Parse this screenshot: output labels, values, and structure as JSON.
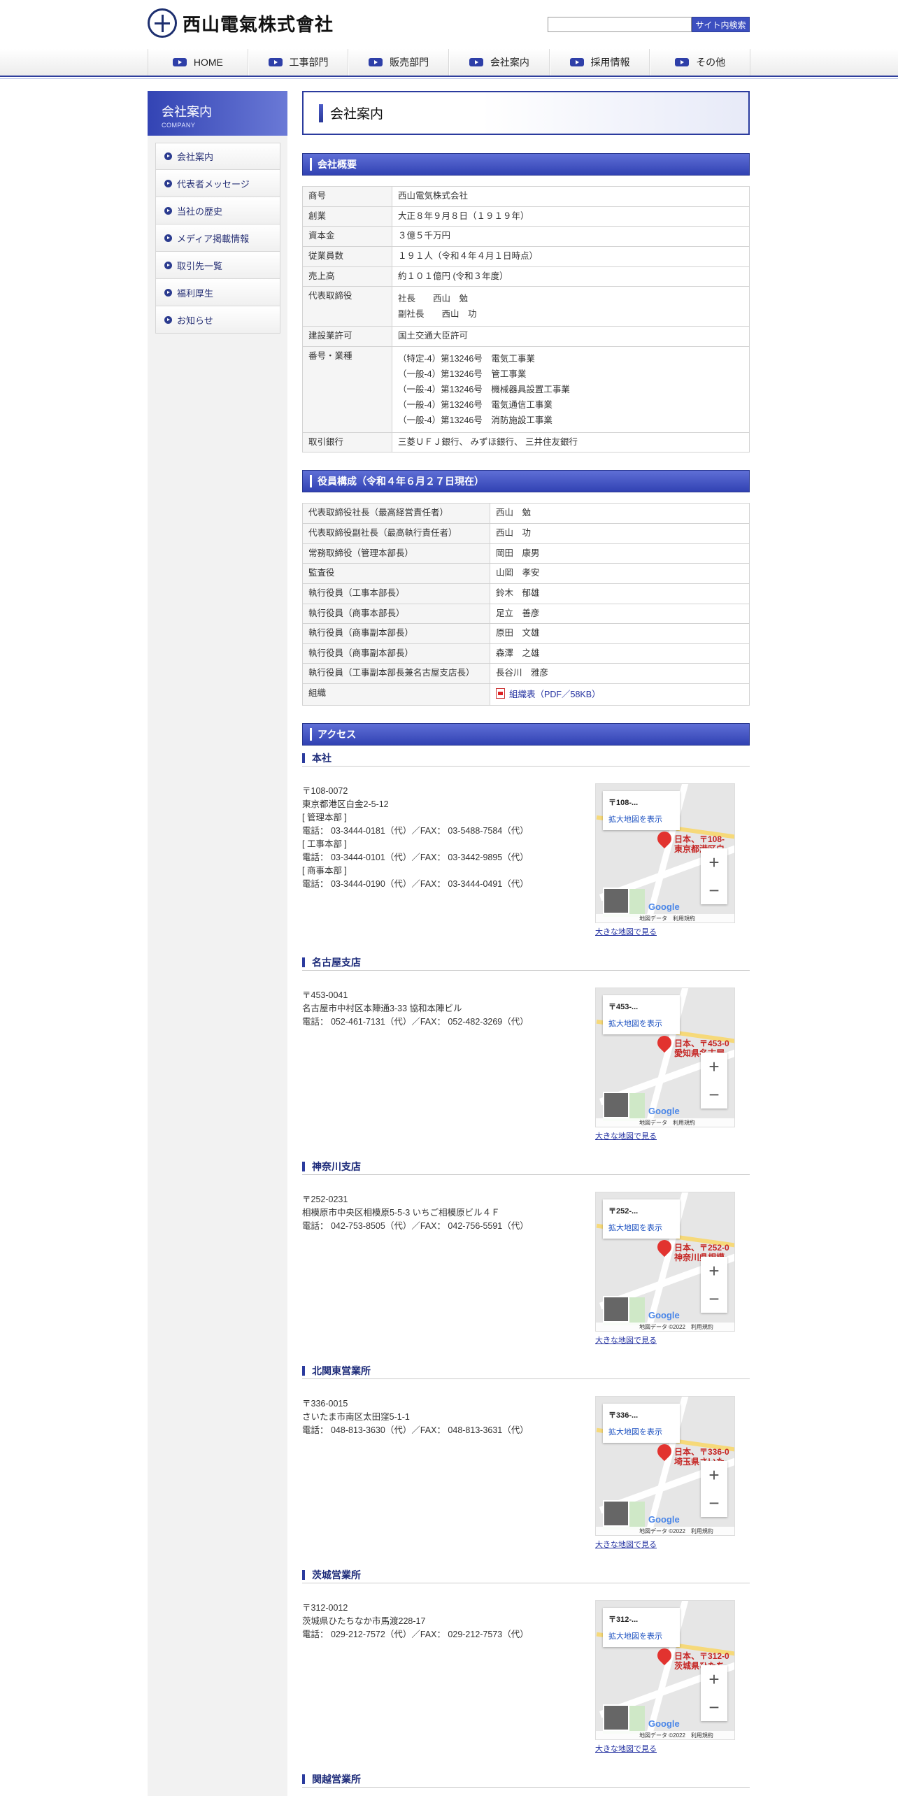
{
  "header": {
    "company_name": "西山電氣株式會社",
    "search_placeholder": "",
    "search_button": "サイト内検索"
  },
  "gnav": [
    {
      "label": "HOME"
    },
    {
      "label": "工事部門"
    },
    {
      "label": "販売部門"
    },
    {
      "label": "会社案内"
    },
    {
      "label": "採用情報"
    },
    {
      "label": "その他"
    }
  ],
  "sidebar": {
    "title": "会社案内",
    "subtitle": "COMPANY",
    "items": [
      {
        "label": "会社案内"
      },
      {
        "label": "代表者メッセージ"
      },
      {
        "label": "当社の歴史"
      },
      {
        "label": "メディア掲載情報"
      },
      {
        "label": "取引先一覧"
      },
      {
        "label": "福利厚生"
      },
      {
        "label": "お知らせ"
      }
    ]
  },
  "page_title": "会社案内",
  "overview": {
    "heading": "会社概要",
    "rows": [
      {
        "k": "商号",
        "v": [
          "西山電気株式会社"
        ]
      },
      {
        "k": "創業",
        "v": [
          "大正８年９月８日（１９１９年）"
        ]
      },
      {
        "k": "資本金",
        "v": [
          "３億５千万円"
        ]
      },
      {
        "k": "従業員数",
        "v": [
          "１９１人（令和４年４月１日時点）"
        ]
      },
      {
        "k": "売上高",
        "v": [
          "約１０１億円 (令和３年度）"
        ]
      },
      {
        "k": "代表取締役",
        "v": [
          "社長　　西山　勉",
          "副社長　　西山　功"
        ]
      },
      {
        "k": "建設業許可",
        "v": [
          "国土交通大臣許可"
        ]
      },
      {
        "k": "番号・業種",
        "v": [
          "（特定-4）第13246号　電気工事業",
          "（一般-4）第13246号　管工事業",
          "（一般-4）第13246号　機械器具設置工事業",
          "（一般-4）第13246号　電気通信工事業",
          "（一般-4）第13246号　消防施設工事業"
        ]
      },
      {
        "k": "取引銀行",
        "v": [
          "三菱ＵＦＪ銀行、 みずほ銀行、 三井住友銀行"
        ]
      }
    ]
  },
  "officers": {
    "heading": "役員構成（令和４年６月２７日現在）",
    "rows": [
      {
        "k": "代表取締役社長（最高経営責任者）",
        "v": "西山　勉"
      },
      {
        "k": "代表取締役副社長（最高執行責任者）",
        "v": "西山　功"
      },
      {
        "k": "常務取締役（管理本部長）",
        "v": "岡田　康男"
      },
      {
        "k": "監査役",
        "v": "山岡　孝安"
      },
      {
        "k": "執行役員（工事本部長）",
        "v": "鈴木　郁雄"
      },
      {
        "k": "執行役員（商事本部長）",
        "v": "足立　善彦"
      },
      {
        "k": "執行役員（商事副本部長）",
        "v": "原田　文雄"
      },
      {
        "k": "執行役員（商事副本部長）",
        "v": "森澤　之雄"
      },
      {
        "k": "執行役員（工事副本部長兼名古屋支店長）",
        "v": "長谷川　雅彦"
      }
    ],
    "org_label": "組織",
    "org_link": "組織表（PDF／58KB）"
  },
  "access": {
    "heading": "アクセス",
    "map_link_label": "拡大地図を表示",
    "big_map_label": "大きな地図で見る",
    "branches": [
      {
        "name": "本社",
        "lines": [
          "〒108-0072",
          "東京都港区白金2-5-12",
          "[ 管理本部 ]",
          "電話： 03-3444-0181（代）／FAX： 03-5488-7584（代）",
          "[ 工事本部 ]",
          "電話： 03-3444-0101（代）／FAX： 03-3442-9895（代）",
          "[ 商事本部 ]",
          "電話： 03-3444-0190（代）／FAX： 03-3444-0491（代）"
        ],
        "map_zip": "108-...",
        "map_pin": "日本、〒108-\n東京都港区白",
        "map_attr": "地図データ　利用規約"
      },
      {
        "name": "名古屋支店",
        "lines": [
          "〒453-0041",
          "名古屋市中村区本陣通3-33 協和本陣ビル",
          "電話： 052-461-7131（代）／FAX： 052-482-3269（代）"
        ],
        "map_zip": "453-...",
        "map_pin": "日本、〒453-0\n愛知県名古屋",
        "map_attr": "地図データ　利用規約"
      },
      {
        "name": "神奈川支店",
        "lines": [
          "〒252-0231",
          "相模原市中央区相模原5-5-3 いちご相模原ビル４Ｆ",
          "電話： 042-753-8505（代）／FAX： 042-756-5591（代）"
        ],
        "map_zip": "252-...",
        "map_pin": "日本、〒252-0\n神奈川県相模",
        "map_attr": "地図データ ©2022　利用規約"
      },
      {
        "name": "北関東営業所",
        "lines": [
          "〒336-0015",
          "さいたま市南区太田窪5-1-1",
          "電話： 048-813-3630（代）／FAX： 048-813-3631（代）"
        ],
        "map_zip": "336-...",
        "map_pin": "日本、〒336-0\n埼玉県さいた",
        "map_attr": "地図データ ©2022　利用規約"
      },
      {
        "name": "茨城営業所",
        "lines": [
          "〒312-0012",
          "茨城県ひたちなか市馬渡228-17",
          "電話： 029-212-7572（代）／FAX： 029-212-7573（代）"
        ],
        "map_zip": "312-...",
        "map_pin": "日本、〒312-0\n茨城県ひたち",
        "map_attr": "地図データ ©2022　利用規約"
      },
      {
        "name": "関越営業所",
        "lines": [],
        "map_zip": "",
        "map_pin": "",
        "map_attr": ""
      }
    ]
  }
}
